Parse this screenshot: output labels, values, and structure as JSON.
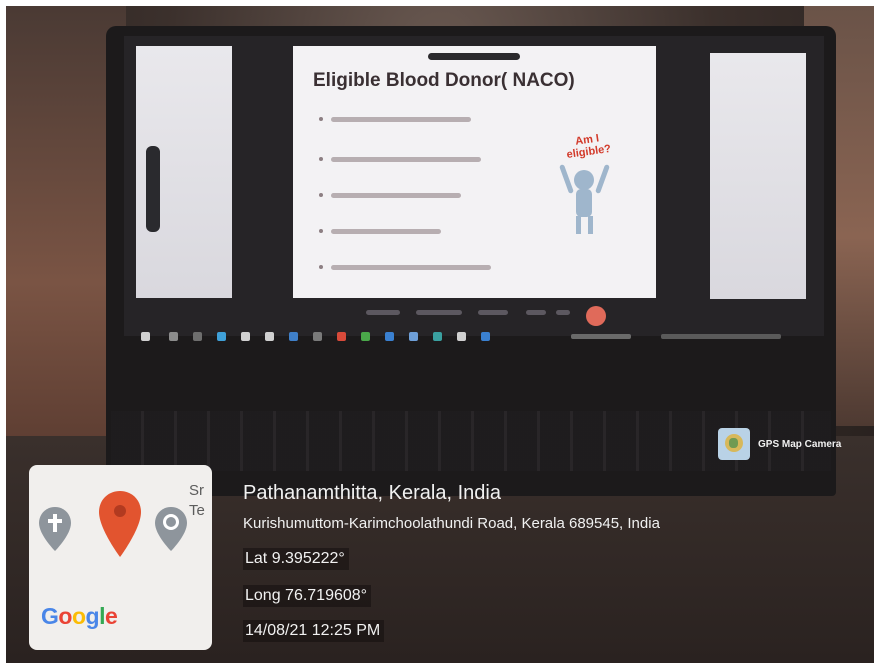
{
  "slide": {
    "title": "Eligible Blood Donor( NACO)",
    "figure_caption": "Am I eligible?"
  },
  "overlay": {
    "badge": "GPS Map Camera",
    "map_partial_text": "Sr\nTe",
    "google_letters": [
      {
        "ch": "G",
        "color": "#4a86e8"
      },
      {
        "ch": "o",
        "color": "#ea4335"
      },
      {
        "ch": "o",
        "color": "#fbbc05"
      },
      {
        "ch": "g",
        "color": "#4a86e8"
      },
      {
        "ch": "l",
        "color": "#34a853"
      },
      {
        "ch": "e",
        "color": "#ea4335"
      }
    ],
    "city": "Pathanamthitta, Kerala, India",
    "address": "Kurishumuttom-Karimchoolathundi Road, Kerala 689545, India",
    "lat": "Lat 9.395222°",
    "long": "Long 76.719608°",
    "datetime": "14/08/21 12:25 PM",
    "icons": {
      "map_pin": "map-pin-icon",
      "church": "church-pin-icon",
      "badge": "globe-icon"
    }
  }
}
